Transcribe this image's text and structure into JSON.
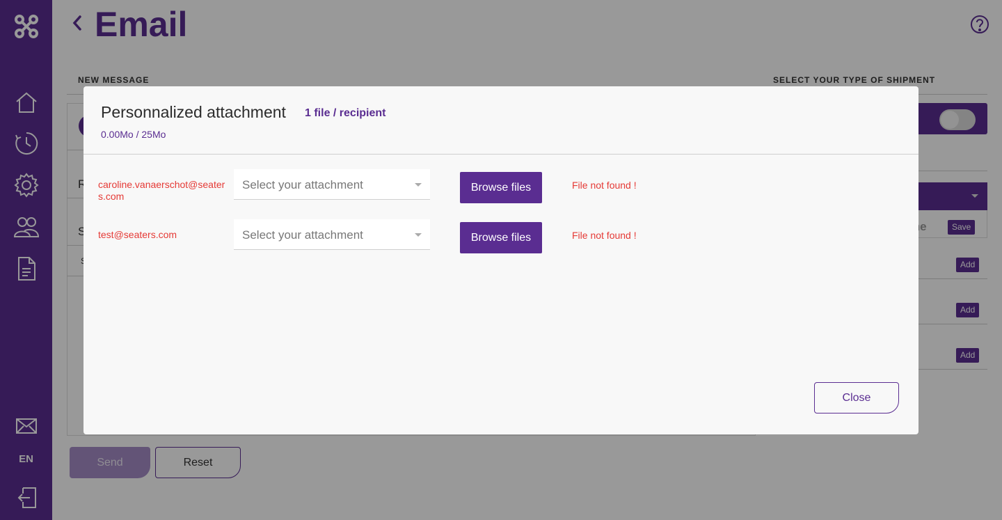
{
  "brand": {
    "primary": "#5a2d91",
    "error": "#e53935"
  },
  "sidebar": {
    "icons": [
      "logo-icon",
      "home-icon",
      "history-icon",
      "settings-icon",
      "users-icon",
      "document-icon",
      "mail-icon",
      "logout-icon"
    ],
    "language": "EN"
  },
  "header": {
    "title": "Email"
  },
  "sections": {
    "new_message": "NEW MESSAGE",
    "shipment_type": "SELECT YOUR TYPE OF SHIPMENT"
  },
  "background_fragments": {
    "r_label": "R",
    "s_label": "S",
    "s_small": "S",
    "name_fragment": "me"
  },
  "right_panel": {
    "save_label": "Save",
    "add_labels": [
      "Add",
      "Add",
      "Add"
    ]
  },
  "footer": {
    "send_label": "Send",
    "reset_label": "Reset"
  },
  "modal": {
    "title": "Personnalized attachment",
    "subtitle": "1 file / recipient",
    "size": "0.00Mo / 25Mo",
    "rows": [
      {
        "email": "caroline.vanaerschot@seaters.com",
        "select_placeholder": "Select your attachment",
        "browse_label": "Browse files",
        "error": "File not found !"
      },
      {
        "email": "test@seaters.com",
        "select_placeholder": "Select your attachment",
        "browse_label": "Browse files",
        "error": "File not found !"
      }
    ],
    "close_label": "Close"
  }
}
